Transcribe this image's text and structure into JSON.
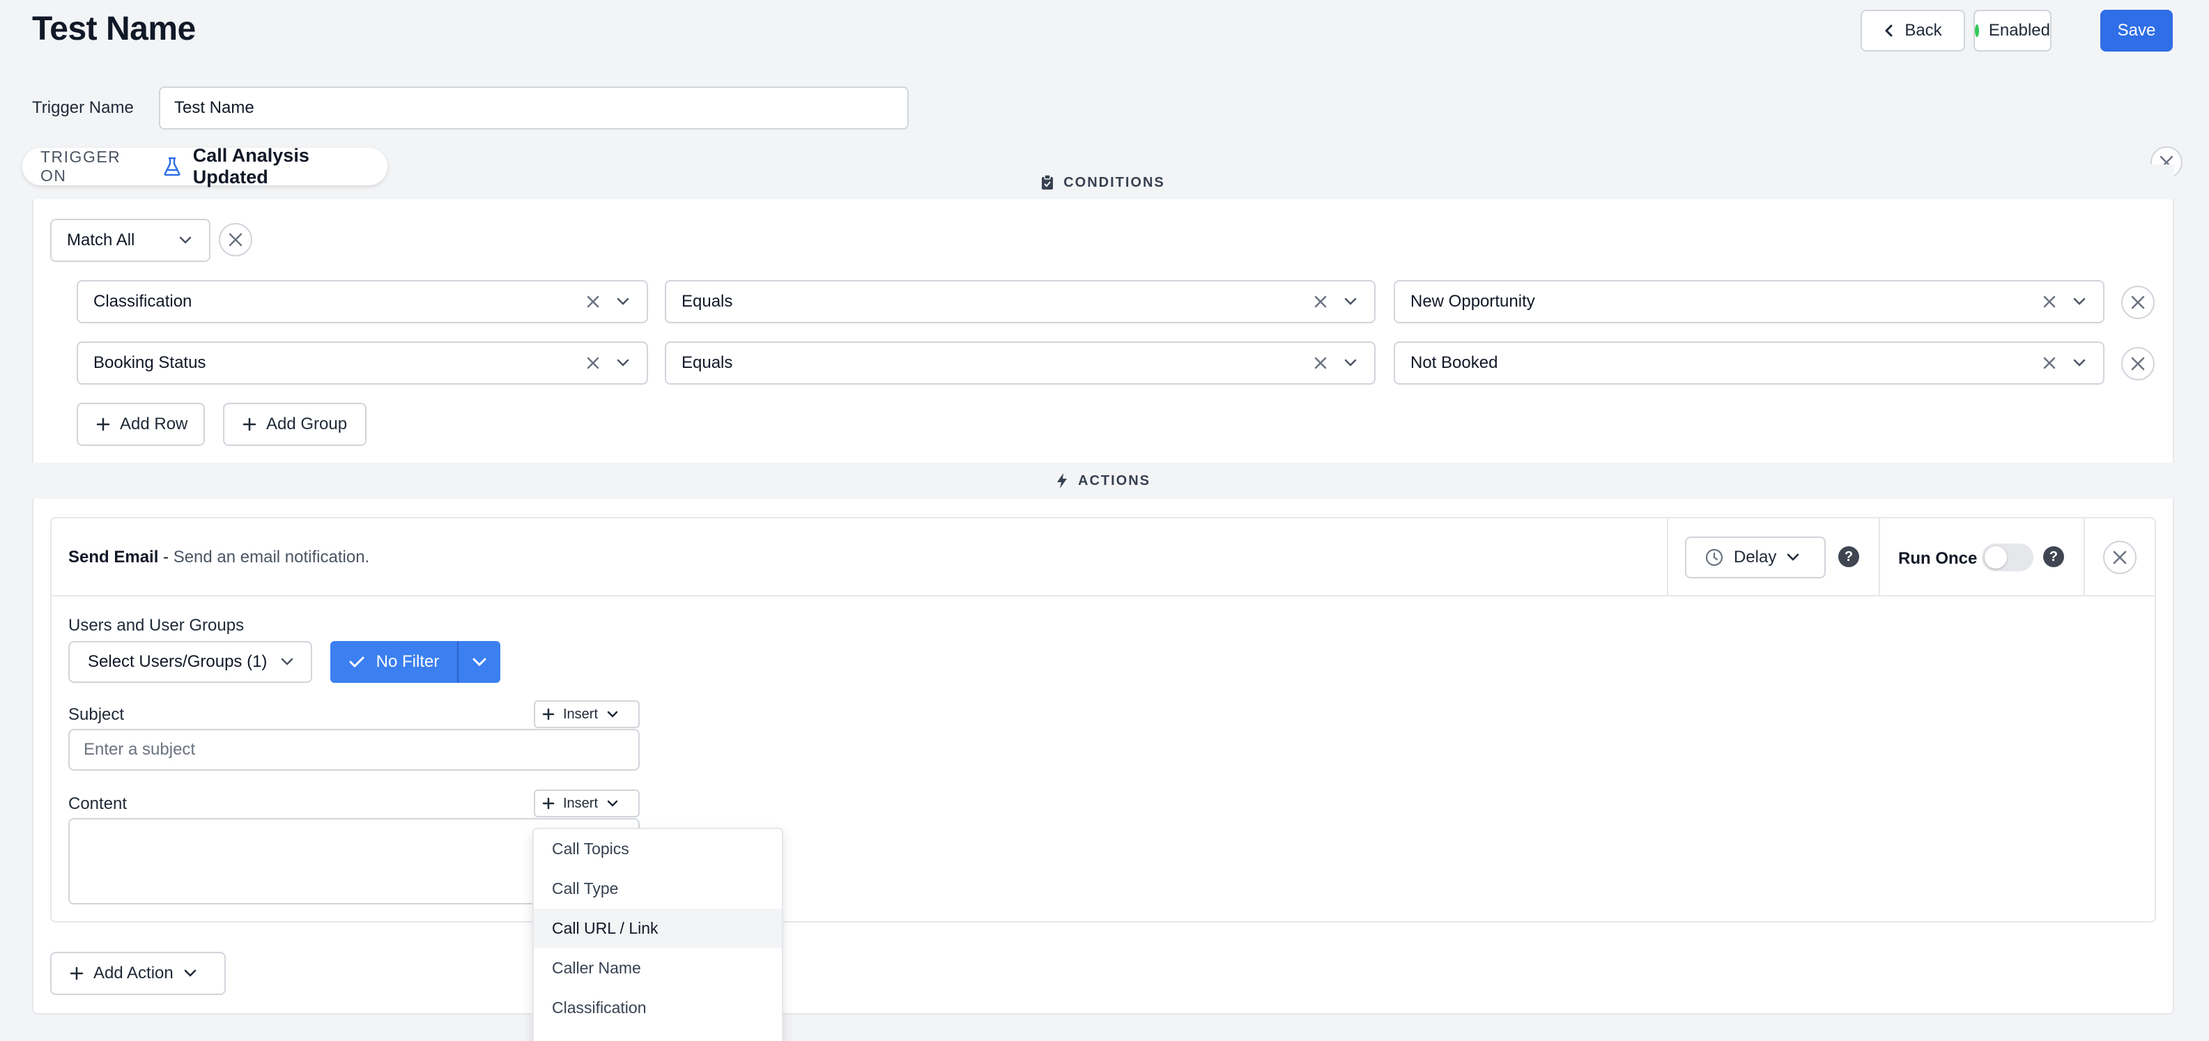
{
  "header": {
    "title": "Test Name",
    "back_label": "Back",
    "enabled_label": "Enabled",
    "save_label": "Save"
  },
  "trigger_name": {
    "label": "Trigger Name",
    "value": "Test Name"
  },
  "trigger": {
    "prefix": "TRIGGER ON",
    "event": "Call Analysis Updated"
  },
  "conditions": {
    "heading": "CONDITIONS",
    "match": "Match All",
    "rows": [
      {
        "field": "Classification",
        "operator": "Equals",
        "value": "New Opportunity"
      },
      {
        "field": "Booking Status",
        "operator": "Equals",
        "value": "Not Booked"
      }
    ],
    "add_row_label": "Add Row",
    "add_group_label": "Add Group"
  },
  "actions": {
    "heading": "ACTIONS",
    "action": {
      "name": "Send Email",
      "separator": " - ",
      "description": "Send an email notification.",
      "delay_label": "Delay",
      "run_once_label": "Run Once",
      "run_once_on": false,
      "users_label": "Users and User Groups",
      "users_select": "Select Users/Groups (1)",
      "filter_label": "No Filter",
      "subject_label": "Subject",
      "subject_placeholder": "Enter a subject",
      "content_label": "Content",
      "insert_label": "Insert"
    },
    "add_action_label": "Add Action"
  },
  "insert_menu": {
    "items": [
      "Call Topics",
      "Call Type",
      "Call URL / Link",
      "Caller Name",
      "Classification"
    ],
    "highlighted_index": 2
  },
  "colors": {
    "primary": "#2f6ee6",
    "filter_button": "#3b7ff0",
    "enabled_dot": "#34c759",
    "background": "#f3f4f6"
  }
}
